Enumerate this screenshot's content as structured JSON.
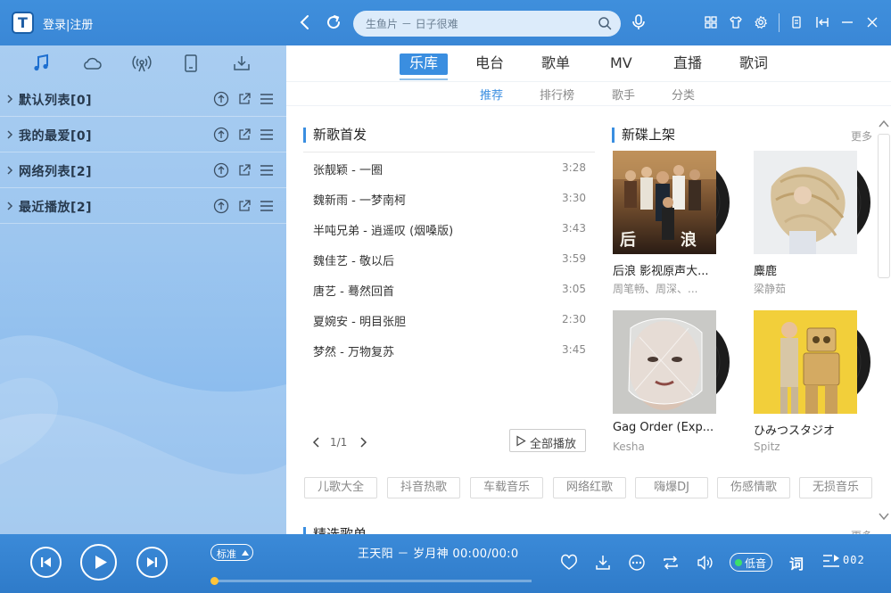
{
  "header": {
    "logo_letter": "T",
    "login_label": "登录|注册",
    "search": {
      "placeholder": "生鱼片 － 日子很难"
    }
  },
  "sidebar": {
    "tabs": [
      {
        "icon": "music-note-icon",
        "active": true
      },
      {
        "icon": "cloud-icon"
      },
      {
        "icon": "radio-signal-icon"
      },
      {
        "icon": "device-icon"
      },
      {
        "icon": "download-icon"
      }
    ],
    "playlists": [
      {
        "label": "默认列表[0]"
      },
      {
        "label": "我的最爱[0]"
      },
      {
        "label": "网络列表[2]"
      },
      {
        "label": "最近播放[2]"
      }
    ]
  },
  "main": {
    "tabs": [
      {
        "label": "乐库",
        "active": true
      },
      {
        "label": "电台"
      },
      {
        "label": "歌单"
      },
      {
        "label": "MV"
      },
      {
        "label": "直播"
      },
      {
        "label": "歌词"
      }
    ],
    "subtabs": [
      {
        "label": "推荐",
        "active": true
      },
      {
        "label": "排行榜"
      },
      {
        "label": "歌手"
      },
      {
        "label": "分类"
      }
    ],
    "new_songs": {
      "title": "新歌首发",
      "songs": [
        {
          "name": "张靓颖 - 一圈",
          "duration": "3:28"
        },
        {
          "name": "魏新雨 - 一梦南柯",
          "duration": "3:30"
        },
        {
          "name": "半吨兄弟 - 逍遥叹 (烟嗓版)",
          "duration": "3:43"
        },
        {
          "name": "魏佳艺 - 敬以后",
          "duration": "3:59"
        },
        {
          "name": "唐艺 - 蓦然回首",
          "duration": "3:05"
        },
        {
          "name": "夏婉安 - 明目张胆",
          "duration": "2:30"
        },
        {
          "name": "梦然 - 万物复苏",
          "duration": "3:45"
        }
      ],
      "pager": "1/1",
      "play_all": "全部播放"
    },
    "new_albums": {
      "title": "新碟上架",
      "more": "更多",
      "albums": [
        {
          "title": "后浪 影视原声大...",
          "artist": "周笔畅、周深、...",
          "cover_text": "后浪"
        },
        {
          "title": "麋鹿",
          "artist": "梁静茹"
        },
        {
          "title": "Gag Order (Exp...",
          "artist": "Kesha"
        },
        {
          "title": "ひみつスタジオ",
          "artist": "Spitz"
        }
      ]
    },
    "tags": [
      "儿歌大全",
      "抖音热歌",
      "车载音乐",
      "网络红歌",
      "嗨爆DJ",
      "伤感情歌",
      "无损音乐"
    ],
    "featured": {
      "title": "精选歌单",
      "more": "更多"
    }
  },
  "player": {
    "quality": "标准",
    "now_playing": "王天阳 － 岁月神 00:00/00:0",
    "progress": 0,
    "low_quality_badge": "低音",
    "lyric_label": "词",
    "queue_count": "002",
    "colors": {
      "accent": "#3a8ee0",
      "bar": "#3a87d6",
      "progress_dot": "#ffc43a",
      "status_dot": "#3de06a"
    }
  }
}
